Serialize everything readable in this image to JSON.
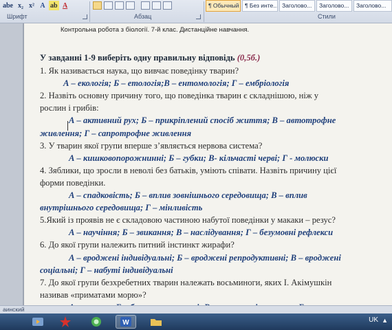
{
  "ribbon": {
    "font_group": "Шрифт",
    "paragraph_group": "Абзац",
    "styles_group": "Стили",
    "styles": [
      "¶ Обычный",
      "¶ Без инте...",
      "Заголово...",
      "Заголово...",
      "Заголово..."
    ],
    "font_buttons": [
      "abe",
      "x₂",
      "x²",
      "A",
      "ab",
      "A"
    ]
  },
  "document": {
    "header": "Контрольна робота з біології. 7-й клас. Дистанційне навчання.",
    "instruction": "У завданні 1-9 виберіть одну правильну відповідь",
    "points": "(0,5б.)",
    "lines": [
      {
        "kind": "q",
        "text": "1. Як називається наука, що вивчає поведінку тварин?"
      },
      {
        "kind": "a",
        "text": "А – екологія; Б – етологія;В – ентомологія; Г – ембріологія"
      },
      {
        "kind": "q",
        "text": "2. Назвіть основну причину того, що поведінка тварин є складнішою, ніж  у"
      },
      {
        "kind": "q",
        "text": "рослин і грибів:"
      },
      {
        "kind": "a",
        "text": "А – активний рух; Б – прикріплений спосіб життя; В – автотрофне"
      },
      {
        "kind": "a",
        "text": "живлення; Г – сапротрофне живлення"
      },
      {
        "kind": "q",
        "text": "3. У тварин якої групи вперше з’являється нервова система?"
      },
      {
        "kind": "a",
        "text": "А – кишковопорожнинні;  Б – губки; В-  кільчасті черві; Г - молюски"
      },
      {
        "kind": "q",
        "text": "4. Зяблики, що зросли в неволі без батьків, уміють співати. Назвіть причину цієї"
      },
      {
        "kind": "q",
        "text": "форми поведінки."
      },
      {
        "kind": "a",
        "text": "А – спадковість; Б – вплив зовнішнього середовища; В – вплив"
      },
      {
        "kind": "a",
        "text": "внутрішнього середовища; Г – мінливість"
      },
      {
        "kind": "q",
        "text": "5.Який із проявів не є складовою  частиною набутої поведінки у макаки – резус?"
      },
      {
        "kind": "a",
        "text": "А – научіння; Б – звикання; В – наслідування; Г – безумовні рефлекси"
      },
      {
        "kind": "q",
        "text": "6. До якої групи  належить питний інстинкт жирафи?"
      },
      {
        "kind": "a",
        "text": "А – вроджені індивідуальні; Б – вроджені репродуктивні; В – вроджені"
      },
      {
        "kind": "a",
        "text": "соціальні; Г – набуті індивідуальні"
      },
      {
        "kind": "q",
        "text": "7. До якої групи безхребетних тварин належать восьминоги, яких І. Акімушкін"
      },
      {
        "kind": "q",
        "text": "називав «приматами морю»?"
      },
      {
        "kind": "a",
        "text": "А – комахи; Б – багатощетинкові; В – головоногі молюски; Г – павуки"
      }
    ]
  },
  "status": {
    "text": "аинский"
  },
  "taskbar": {
    "lang": "UK",
    "items": [
      "windows-media-player-icon",
      "star-app-icon",
      "green-app-icon",
      "word-icon",
      "folder-icon"
    ]
  }
}
